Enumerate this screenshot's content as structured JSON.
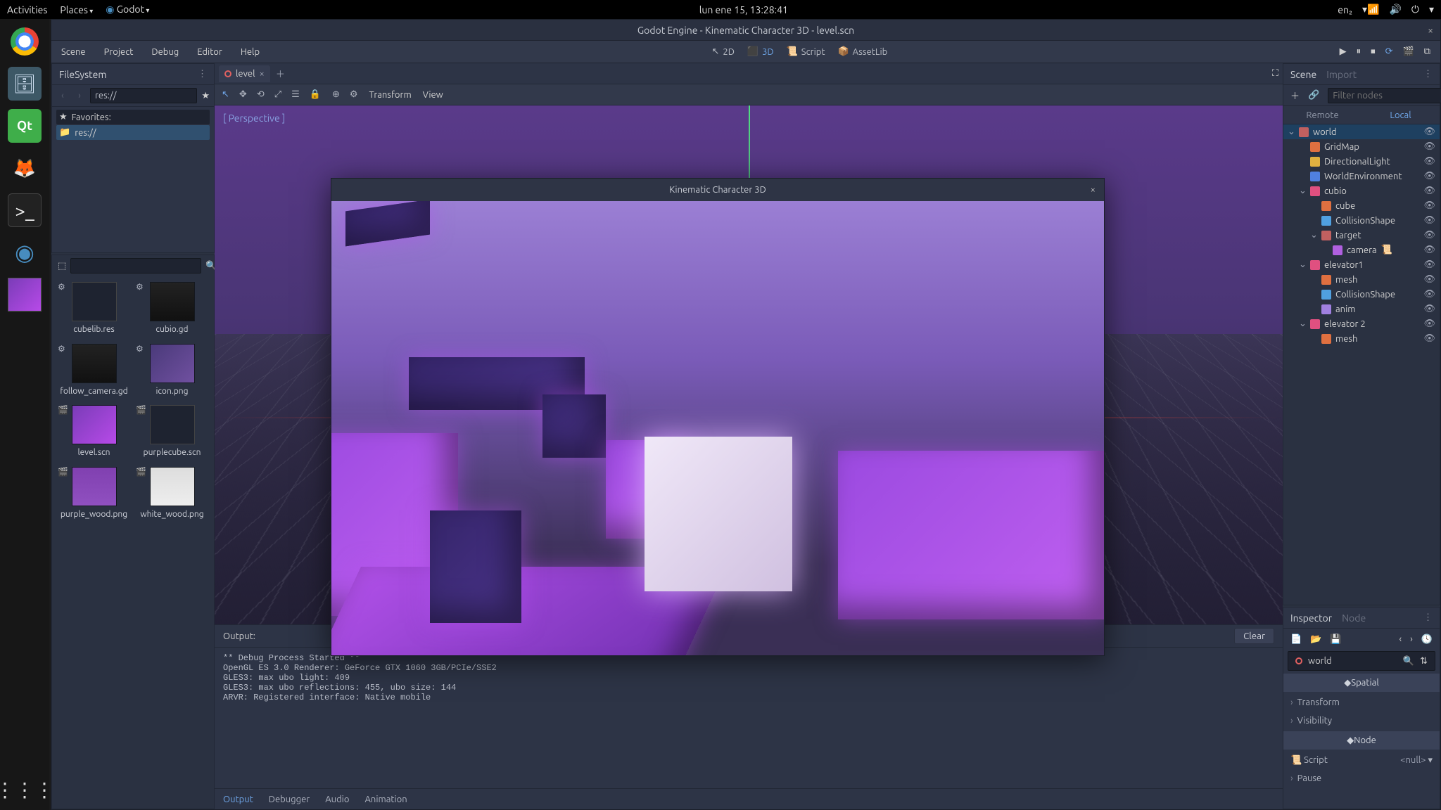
{
  "gnome": {
    "activities": "Activities",
    "places": "Places",
    "app": "Godot",
    "clock": "lun ene 15, 13:28:41",
    "lang": "en₂"
  },
  "window_title": "Godot Engine - Kinematic Character 3D - level.scn",
  "menu": {
    "scene": "Scene",
    "project": "Project",
    "debug": "Debug",
    "editor": "Editor",
    "help": "Help"
  },
  "workspaces": {
    "2d": "2D",
    "3d": "3D",
    "script": "Script",
    "assetlib": "AssetLib"
  },
  "filesystem": {
    "title": "FileSystem",
    "path": "res://",
    "favorites": "Favorites:",
    "res": "res://",
    "files": [
      {
        "name": "cubelib.res",
        "thumb": "doc"
      },
      {
        "name": "cubio.gd",
        "thumb": "code"
      },
      {
        "name": "follow_camera.gd",
        "thumb": "code"
      },
      {
        "name": "icon.png",
        "thumb": "img"
      },
      {
        "name": "level.scn",
        "thumb": "scene"
      },
      {
        "name": "purplecube.scn",
        "thumb": "doc"
      },
      {
        "name": "purple_wood.png",
        "thumb": "tex"
      },
      {
        "name": "white_wood.png",
        "thumb": "tex2"
      }
    ]
  },
  "scene_tab": "level",
  "viewport_menu": {
    "transform": "Transform",
    "view": "View"
  },
  "perspective": "[ Perspective ]",
  "game_title": "Kinematic Character 3D",
  "output": {
    "label": "Output:",
    "clear": "Clear",
    "text": "** Debug Process Started **\nOpenGL ES 3.0 Renderer: GeForce GTX 1060 3GB/PCIe/SSE2\nGLES3: max ubo light: 409\nGLES3: max ubo reflections: 455, ubo size: 144\nARVR: Registered interface: Native mobile",
    "tabs": {
      "output": "Output",
      "debugger": "Debugger",
      "audio": "Audio",
      "animation": "Animation"
    }
  },
  "scene_panel": {
    "tab_scene": "Scene",
    "tab_import": "Import",
    "filter_ph": "Filter nodes",
    "remote": "Remote",
    "local": "Local",
    "nodes": [
      {
        "name": "world",
        "icon": "#c06060",
        "ind": 0,
        "exp": true,
        "sel": true
      },
      {
        "name": "GridMap",
        "icon": "#e07040",
        "ind": 1
      },
      {
        "name": "DirectionalLight",
        "icon": "#e0b040",
        "ind": 1
      },
      {
        "name": "WorldEnvironment",
        "icon": "#5080e0",
        "ind": 1
      },
      {
        "name": "cubio",
        "icon": "#e05080",
        "ind": 1,
        "exp": true
      },
      {
        "name": "cube",
        "icon": "#e07040",
        "ind": 2
      },
      {
        "name": "CollisionShape",
        "icon": "#50a0e0",
        "ind": 2
      },
      {
        "name": "target",
        "icon": "#c06060",
        "ind": 2,
        "exp": true
      },
      {
        "name": "camera",
        "icon": "#b060e0",
        "ind": 3,
        "script": true
      },
      {
        "name": "elevator1",
        "icon": "#e05080",
        "ind": 1,
        "exp": true
      },
      {
        "name": "mesh",
        "icon": "#e07040",
        "ind": 2
      },
      {
        "name": "CollisionShape",
        "icon": "#50a0e0",
        "ind": 2
      },
      {
        "name": "anim",
        "icon": "#a080e0",
        "ind": 2
      },
      {
        "name": "elevator 2",
        "icon": "#e05080",
        "ind": 1,
        "exp": true
      },
      {
        "name": "mesh",
        "icon": "#e07040",
        "ind": 2
      }
    ]
  },
  "inspector": {
    "tab_inspector": "Inspector",
    "tab_node": "Node",
    "object": "world",
    "cat_spatial": "Spatial",
    "prop_transform": "Transform",
    "prop_visibility": "Visibility",
    "cat_node": "Node",
    "prop_script": "Script",
    "prop_script_val": "<null>",
    "prop_pause": "Pause"
  }
}
